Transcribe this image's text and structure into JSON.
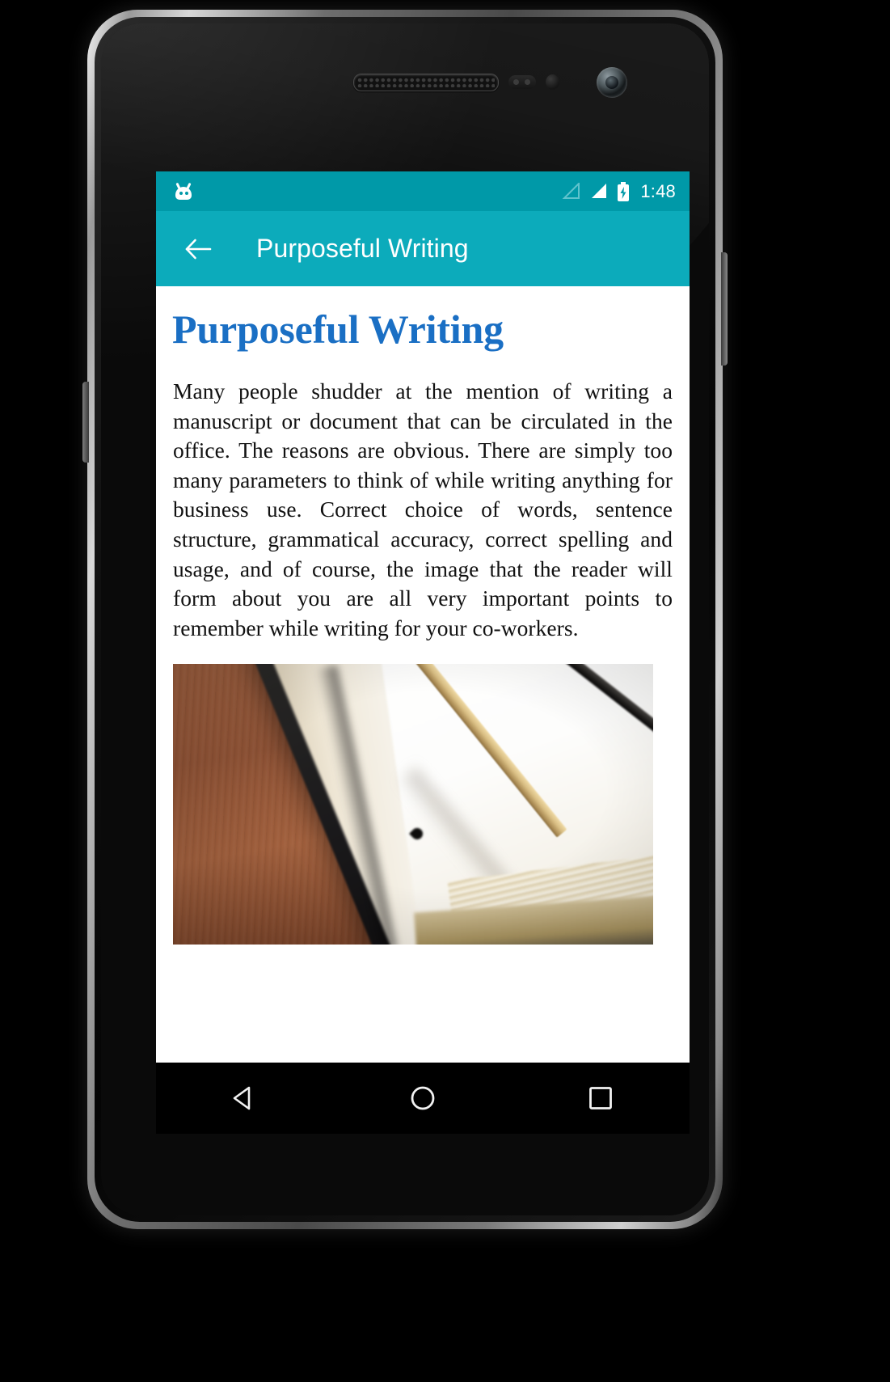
{
  "device": {
    "type": "android-phone-mockup",
    "hardware_icons": {
      "earpiece": "earpiece-speaker",
      "proximity_sensor": "proximity-sensor",
      "light_sensor": "light-sensor",
      "front_camera": "front-camera"
    }
  },
  "status_bar": {
    "background_color": "#0099a8",
    "notification_icon": "android-head-icon",
    "signal_empty_icon": "signal-no-service-icon",
    "signal_full_icon": "signal-full-icon",
    "battery_icon": "battery-charging-icon",
    "time": "1:48"
  },
  "action_bar": {
    "background_color": "#0cabbb",
    "back_icon": "arrow-back-icon",
    "title": "Purposeful Writing"
  },
  "content": {
    "background_color": "#ffffff",
    "title": "Purposeful Writing",
    "title_color": "#1a6fc4",
    "body": "Many people shudder at the mention of writing a manuscript or document that can be circulated in the office. The reasons are obvious. There are simply too many parameters to think of while writing anything for business use. Correct choice of words, sentence structure, grammatical accuracy, correct spelling and usage, and of course, the image that the reader will form about you are all very important points to remember while writing for your co-workers.",
    "photo": {
      "name": "open-notebook-with-pencil-photo",
      "description": "Blurred photo of an open blank notebook with a sharpened pencil resting on the page, on a wooden desk"
    }
  },
  "nav_bar": {
    "background_color": "#000000",
    "buttons": [
      {
        "name": "nav-back-button",
        "icon": "triangle-back-icon"
      },
      {
        "name": "nav-home-button",
        "icon": "circle-home-icon"
      },
      {
        "name": "nav-recents-button",
        "icon": "square-recents-icon"
      }
    ]
  }
}
